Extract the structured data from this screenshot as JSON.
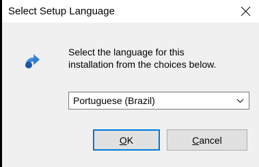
{
  "dialog": {
    "title": "Select Setup Language",
    "close_icon": "close-icon",
    "setup_icon": "setup-arrow-icon",
    "message_line1": "Select the language for this",
    "message_line2": "installation from the choices below.",
    "language_select": {
      "selected": "Portuguese (Brazil)",
      "chevron_icon": "chevron-down-icon"
    },
    "buttons": {
      "ok_label": "OK",
      "cancel_label": "Cancel"
    },
    "colors": {
      "accent": "#0078d7",
      "background": "#f0f0f0"
    }
  }
}
